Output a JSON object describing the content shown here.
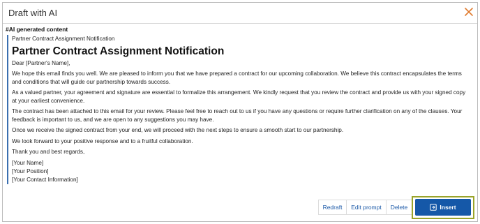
{
  "dialog": {
    "title": "Draft with AI",
    "close_icon": "close-icon"
  },
  "content": {
    "label": "#AI generated content",
    "subject_line": "Partner Contract Assignment Notification",
    "heading": "Partner Contract Assignment Notification",
    "greeting": "Dear [Partner's Name],",
    "paragraphs": [
      "We hope this email finds you well. We are pleased to inform you that we have prepared a contract for our upcoming collaboration. We believe this contract encapsulates the terms and conditions that will guide our partnership towards success.",
      "As a valued partner, your agreement and signature are essential to formalize this arrangement. We kindly request that you review the contract and provide us with your signed copy at your earliest convenience.",
      "The contract has been attached to this email for your review. Please feel free to reach out to us if you have any questions or require further clarification on any of the clauses. Your feedback is important to us, and we are open to any suggestions you may have.",
      "Once we receive the signed contract from your end, we will proceed with the next steps to ensure a smooth start to our partnership.",
      "We look forward to your positive response and to a fruitful collaboration.",
      "Thank you and best regards,"
    ],
    "signature": [
      "[Your Name]",
      "[Your Position]",
      "[Your Contact Information]"
    ]
  },
  "actions": {
    "redraft": "Redraft",
    "edit_prompt": "Edit prompt",
    "delete": "Delete",
    "insert": "Insert",
    "insert_icon": "insert-icon"
  },
  "colors": {
    "accent": "#1558a8",
    "highlight": "#9aa42a",
    "close": "#e07a2e",
    "quote_bar": "#3a6fb0"
  }
}
